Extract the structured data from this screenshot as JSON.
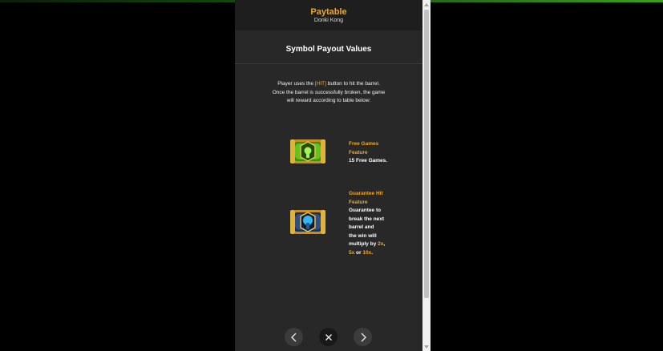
{
  "header": {
    "title": "Paytable",
    "subtitle": "Donki Kong"
  },
  "section": {
    "title": "Symbol Payout Values"
  },
  "description": {
    "part1": "Player uses the ",
    "hit": "[HIT]",
    "part2": " button to hit the barrel.",
    "line2": "Once the barrel is successfully broken, the game",
    "line3": "will reward according to table below:"
  },
  "symbols": [
    {
      "icon": "green-barrel-icon",
      "name_line1": "Free Games",
      "name_line2": "Feature",
      "text": "15 Free Games."
    },
    {
      "icon": "blue-barrel-icon",
      "name_line1": "Guarantee Hit",
      "name_line2": "Feature",
      "lines": [
        "Guarantee to",
        "break the next",
        "barrel and",
        "the win will"
      ],
      "multiply_text": "multiply by ",
      "m1": "2x",
      "sep1": ",",
      "m2": "5x",
      "or_text": " or ",
      "m3": "10x",
      "end": "."
    }
  ],
  "nav": {
    "prev_icon": "chevron-left-icon",
    "close_icon": "close-icon",
    "next_icon": "chevron-right-icon"
  },
  "colors": {
    "accent": "#f0a823",
    "panel": "#282828",
    "header": "#1e1e1e"
  }
}
